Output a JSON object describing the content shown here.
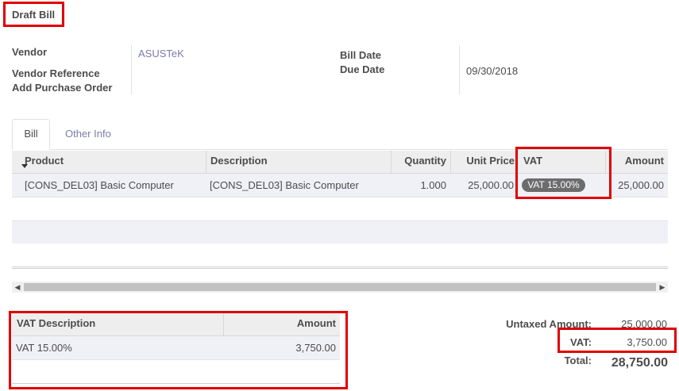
{
  "title": "Draft Bill",
  "form": {
    "vendor_label": "Vendor",
    "vendor_value": "ASUSTeK",
    "vendor_ref_label": "Vendor Reference",
    "add_po_label": "Add Purchase Order",
    "bill_date_label": "Bill Date",
    "due_date_label": "Due Date",
    "due_date_value": "09/30/2018"
  },
  "tabs": [
    {
      "label": "Bill",
      "active": true
    },
    {
      "label": "Other Info",
      "active": false
    }
  ],
  "lines": {
    "columns": [
      "Product",
      "Description",
      "Quantity",
      "Unit Price",
      "VAT",
      "Amount"
    ],
    "rows": [
      {
        "product": "[CONS_DEL03] Basic Computer",
        "description": "[CONS_DEL03] Basic Computer",
        "quantity": "1.000",
        "unit_price": "25,000.00",
        "vat": "VAT 15.00%",
        "amount": "25,000.00"
      }
    ]
  },
  "tax_table": {
    "columns": [
      "VAT Description",
      "Amount"
    ],
    "rows": [
      {
        "description": "VAT 15.00%",
        "amount": "3,750.00"
      }
    ]
  },
  "totals": {
    "untaxed_label": "Untaxed Amount:",
    "untaxed_value": "25,000.00",
    "vat_label": "VAT:",
    "vat_value": "3,750.00",
    "total_label": "Total:",
    "total_value": "28,750.00"
  },
  "colors": {
    "highlight": "#e00000",
    "link": "#7c7bad",
    "tag_bg": "#6c6c6c"
  }
}
